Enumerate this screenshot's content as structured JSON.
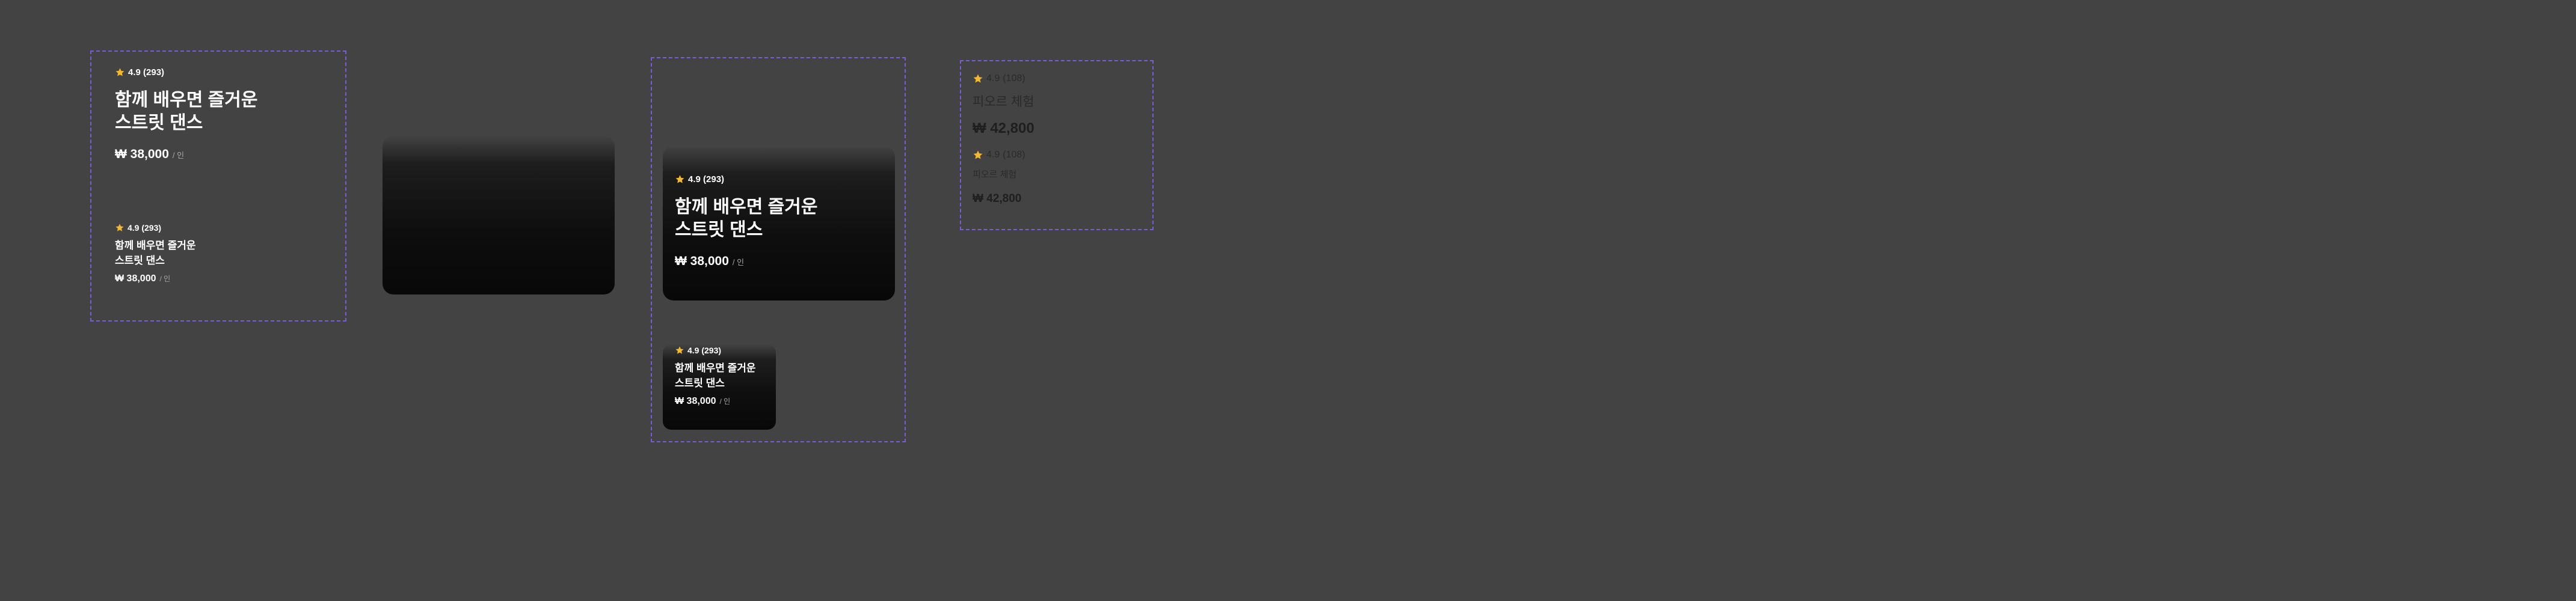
{
  "colors": {
    "background": "#434343",
    "frame_border": "#7b5cd6",
    "star": "#f5b82e",
    "text": "#ffffff",
    "unit_text": "#a8a8a8"
  },
  "icons": {
    "rating": "star-icon"
  },
  "product_card": {
    "rating": "4.9 (293)",
    "title": "함께 배우면 즐거운\n스트릿 댄스",
    "price": "₩ 38,000",
    "unit": "/ 인"
  },
  "minimal_card": {
    "rating_value": "4.9",
    "review_count": "(108)",
    "title": "피오르 체험",
    "price": "₩ 42,800"
  }
}
